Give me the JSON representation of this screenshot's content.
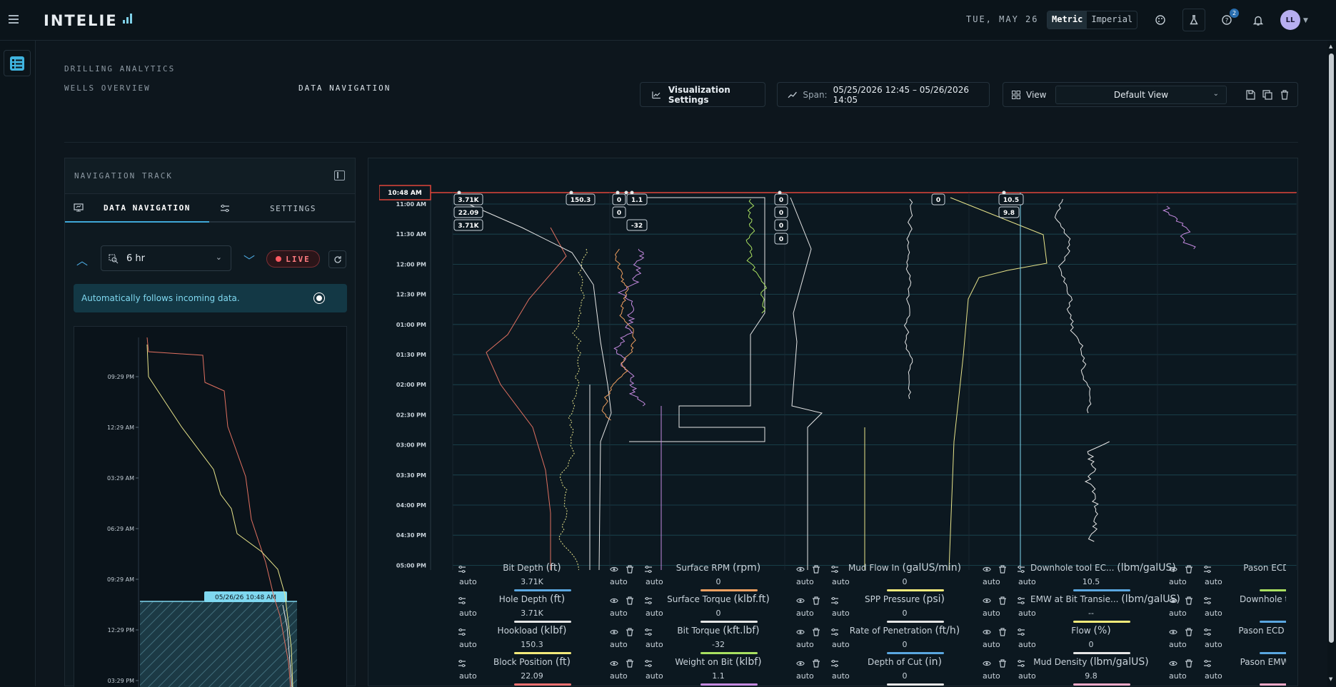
{
  "app": {
    "logo": "INTELIE",
    "date": "TUE, MAY 26",
    "units": [
      "Metric",
      "Imperial"
    ],
    "active_unit": "Metric",
    "notification_count": "2",
    "avatar_initials": "LL"
  },
  "breadcrumb": {
    "section": "DRILLING ANALYTICS",
    "parent": "WELLS OVERVIEW",
    "current": "DATA NAVIGATION"
  },
  "toolbar": {
    "visualization_settings": "Visualization Settings",
    "span_label": "Span:",
    "span_value": "05/25/2026 12:45 – 05/26/2026 14:05",
    "view_label": "View",
    "view_value": "Default View"
  },
  "nav_track": {
    "title": "NAVIGATION TRACK",
    "tabs": [
      "DATA NAVIGATION",
      "SETTINGS"
    ],
    "range": "6 hr",
    "live": "LIVE",
    "follow_text": "Automatically follows incoming data.",
    "mini_ticks": [
      "09:29 PM",
      "12:29 AM",
      "03:29 AM",
      "06:29 AM",
      "09:29 AM",
      "12:29 PM",
      "03:29 PM"
    ],
    "window_label": "05/26/26 10:48 AM"
  },
  "chart": {
    "cursor_time": "10:48 AM",
    "time_ticks": [
      "11:00 AM",
      "11:30 AM",
      "12:00 PM",
      "12:30 PM",
      "01:00 PM",
      "01:30 PM",
      "02:00 PM",
      "02:30 PM",
      "03:00 PM",
      "03:30 PM",
      "04:00 PM",
      "04:30 PM",
      "05:00 PM"
    ],
    "value_tags": [
      "3.71K",
      "22.09",
      "3.71K",
      "150.3",
      "0",
      "1.1",
      "0",
      "-32",
      "0",
      "0",
      "0",
      "0",
      "0",
      "10.5",
      "9.8"
    ]
  },
  "legend": {
    "auto": "auto",
    "rows": [
      [
        {
          "name": "Bit Depth",
          "unit": "(ft)",
          "value": "3.71K",
          "color": "#5aa7e0"
        },
        {
          "name": "Surface RPM",
          "unit": "(rpm)",
          "value": "0",
          "color": "#f0a060"
        },
        {
          "name": "Mud Flow In",
          "unit": "(galUS/min)",
          "value": "0",
          "color": "#f4ea7a"
        },
        {
          "name": "Downhole tool EC...",
          "unit": "(lbm/galUS)",
          "value": "10.5",
          "color": "#5aa7e0"
        },
        {
          "name": "Pason ECD at Bi",
          "unit": "",
          "value": "",
          "color": "#a9e060"
        }
      ],
      [
        {
          "name": "Hole Depth",
          "unit": "(ft)",
          "value": "3.71K",
          "color": "#e6e6e6"
        },
        {
          "name": "Surface Torque",
          "unit": "(klbf.ft)",
          "value": "0",
          "color": "#e6e6e6"
        },
        {
          "name": "SPP Pressure",
          "unit": "(psi)",
          "value": "0",
          "color": "#e6e6e6"
        },
        {
          "name": "EMW at Bit Transie...",
          "unit": "(lbm/galUS)",
          "value": "--",
          "color": "#f4ea7a"
        },
        {
          "name": "Downhole tool EC",
          "unit": "",
          "value": "",
          "color": "#5aa7e0"
        }
      ],
      [
        {
          "name": "Hookload",
          "unit": "(klbf)",
          "value": "150.3",
          "color": "#f4ea7a"
        },
        {
          "name": "Bit Torque",
          "unit": "(kft.lbf)",
          "value": "-32",
          "color": "#a9e060"
        },
        {
          "name": "Rate of Penetration",
          "unit": "(ft/h)",
          "value": "0",
          "color": "#5aa7e0"
        },
        {
          "name": "Flow",
          "unit": "(%)",
          "value": "0",
          "color": "#e6e6e6"
        },
        {
          "name": "Pason ECD at Casi",
          "unit": "",
          "value": "",
          "color": "#5aa7e0"
        }
      ],
      [
        {
          "name": "Block Position",
          "unit": "(ft)",
          "value": "22.09",
          "color": "#f07070"
        },
        {
          "name": "Weight on Bit",
          "unit": "(klbf)",
          "value": "1.1",
          "color": "#c58ae0"
        },
        {
          "name": "Depth of Cut",
          "unit": "(in)",
          "value": "0",
          "color": "#e6e6e6"
        },
        {
          "name": "Mud Density",
          "unit": "(lbm/galUS)",
          "value": "9.8",
          "color": "#f4a9c8"
        },
        {
          "name": "Pason EMW at Bit",
          "unit": "",
          "value": "",
          "color": "#f4a9c8"
        }
      ]
    ]
  }
}
